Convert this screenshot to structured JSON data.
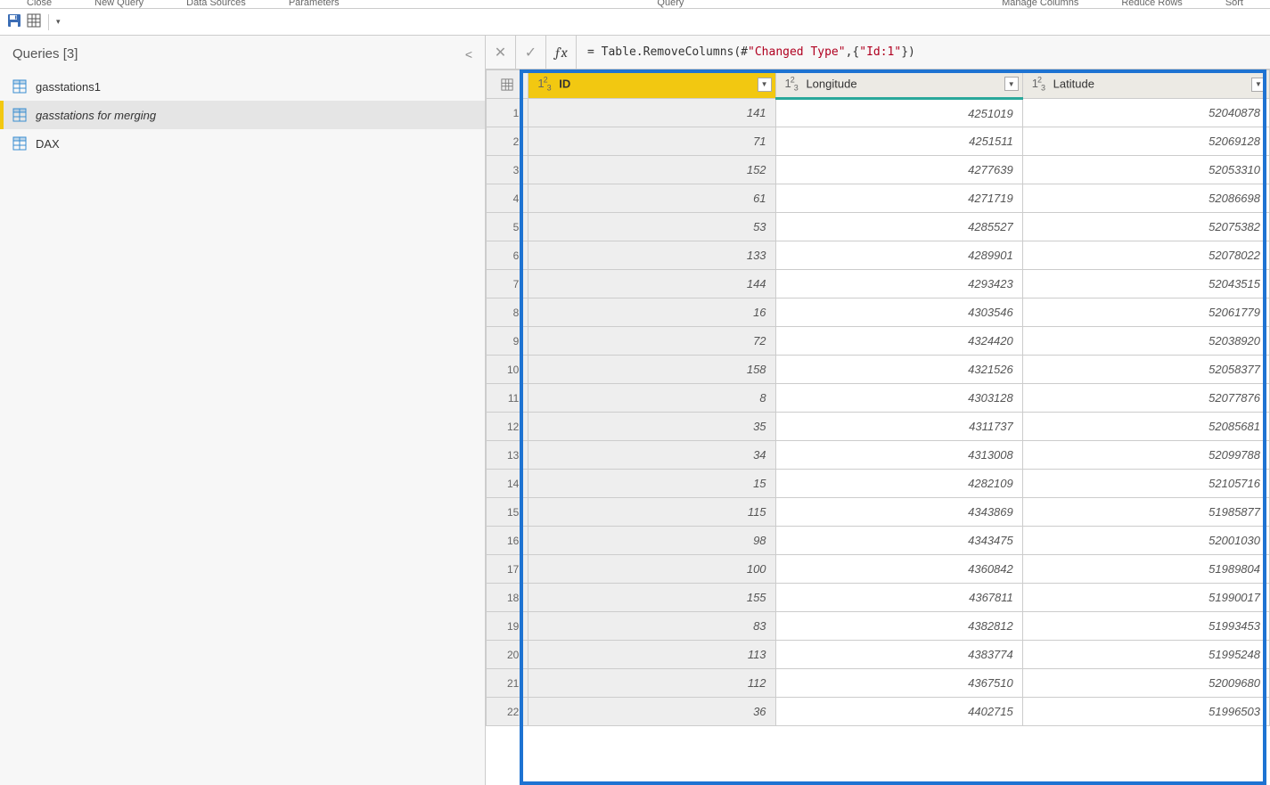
{
  "ribbon_groups": {
    "close": "Close",
    "new_query": "New Query",
    "data_sources": "Data Sources",
    "parameters": "Parameters",
    "query": "Query",
    "manage_columns": "Manage Columns",
    "reduce_rows": "Reduce Rows",
    "sort": "Sort"
  },
  "queries_panel": {
    "title": "Queries [3]",
    "items": [
      {
        "label": "gasstations1"
      },
      {
        "label": "gasstations for merging"
      },
      {
        "label": "DAX"
      }
    ]
  },
  "formula_bar": {
    "prefix": "= Table.RemoveColumns(#",
    "str1": "\"Changed Type\"",
    "mid": ",{",
    "str2": "\"Id:1\"",
    "suffix": "})"
  },
  "columns": [
    {
      "name": "ID",
      "type_prefix": "1",
      "type_sup": "2",
      "type_sub": "3"
    },
    {
      "name": "Longitude",
      "type_prefix": "1",
      "type_sup": "2",
      "type_sub": "3"
    },
    {
      "name": "Latitude",
      "type_prefix": "1",
      "type_sup": "2",
      "type_sub": "3"
    }
  ],
  "rows": [
    {
      "n": "1",
      "id": "141",
      "lon": "4251019",
      "lat": "52040878"
    },
    {
      "n": "2",
      "id": "71",
      "lon": "4251511",
      "lat": "52069128"
    },
    {
      "n": "3",
      "id": "152",
      "lon": "4277639",
      "lat": "52053310"
    },
    {
      "n": "4",
      "id": "61",
      "lon": "4271719",
      "lat": "52086698"
    },
    {
      "n": "5",
      "id": "53",
      "lon": "4285527",
      "lat": "52075382"
    },
    {
      "n": "6",
      "id": "133",
      "lon": "4289901",
      "lat": "52078022"
    },
    {
      "n": "7",
      "id": "144",
      "lon": "4293423",
      "lat": "52043515"
    },
    {
      "n": "8",
      "id": "16",
      "lon": "4303546",
      "lat": "52061779"
    },
    {
      "n": "9",
      "id": "72",
      "lon": "4324420",
      "lat": "52038920"
    },
    {
      "n": "10",
      "id": "158",
      "lon": "4321526",
      "lat": "52058377"
    },
    {
      "n": "11",
      "id": "8",
      "lon": "4303128",
      "lat": "52077876"
    },
    {
      "n": "12",
      "id": "35",
      "lon": "4311737",
      "lat": "52085681"
    },
    {
      "n": "13",
      "id": "34",
      "lon": "4313008",
      "lat": "52099788"
    },
    {
      "n": "14",
      "id": "15",
      "lon": "4282109",
      "lat": "52105716"
    },
    {
      "n": "15",
      "id": "115",
      "lon": "4343869",
      "lat": "51985877"
    },
    {
      "n": "16",
      "id": "98",
      "lon": "4343475",
      "lat": "52001030"
    },
    {
      "n": "17",
      "id": "100",
      "lon": "4360842",
      "lat": "51989804"
    },
    {
      "n": "18",
      "id": "155",
      "lon": "4367811",
      "lat": "51990017"
    },
    {
      "n": "19",
      "id": "83",
      "lon": "4382812",
      "lat": "51993453"
    },
    {
      "n": "20",
      "id": "113",
      "lon": "4383774",
      "lat": "51995248"
    },
    {
      "n": "21",
      "id": "112",
      "lon": "4367510",
      "lat": "52009680"
    },
    {
      "n": "22",
      "id": "36",
      "lon": "4402715",
      "lat": "51996503"
    }
  ]
}
